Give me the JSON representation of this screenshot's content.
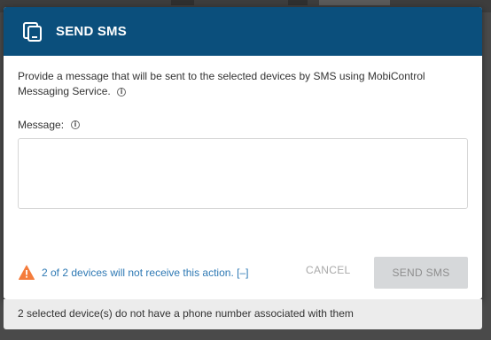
{
  "dialog": {
    "title": "SEND SMS",
    "description": "Provide a message that will be sent to the selected devices by SMS using MobiControl Messaging Service.",
    "info_glyph": "i",
    "message_label": "Message:",
    "message_value": "",
    "message_placeholder": ""
  },
  "footer": {
    "warning_text": "2 of 2 devices will not receive this action. [–]",
    "cancel_label": "CANCEL",
    "send_label": "SEND SMS"
  },
  "toast": {
    "text": "2 selected device(s) do not have a phone number associated with them"
  },
  "colors": {
    "header": "#0b4f7c",
    "warning": "#f47c3c",
    "link": "#2e79b4",
    "disabled_button": "#d6d8da"
  },
  "icons": {
    "header": "send-sms-icon",
    "info": "info-icon",
    "warning": "warning-icon"
  }
}
